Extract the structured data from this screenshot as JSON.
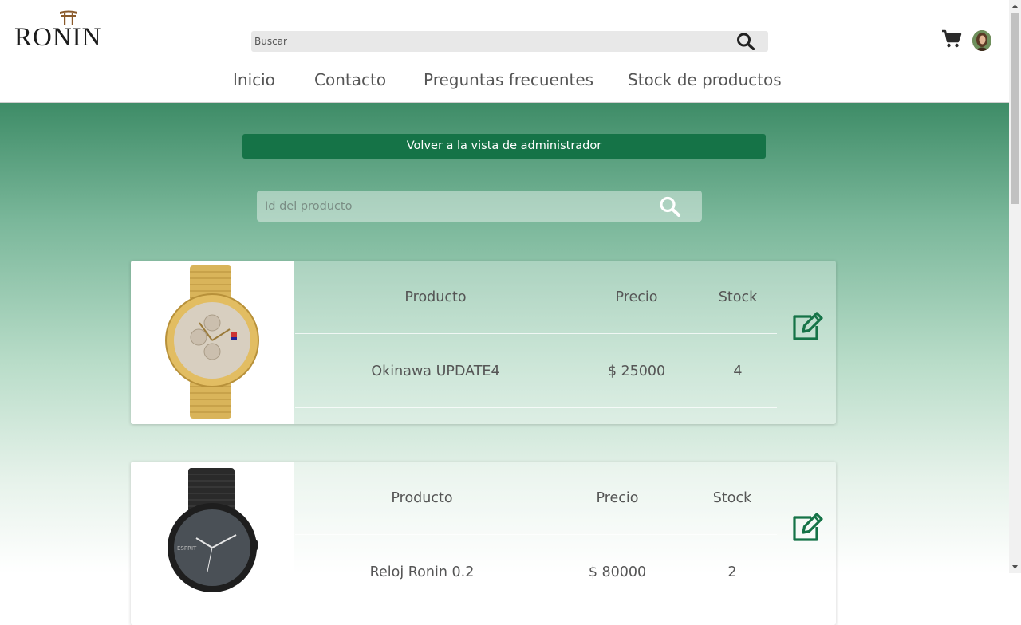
{
  "brand": {
    "logo_text": "RONIN"
  },
  "search": {
    "placeholder": "Buscar"
  },
  "nav": {
    "items": [
      {
        "label": "Inicio"
      },
      {
        "label": "Contacto"
      },
      {
        "label": "Preguntas frecuentes"
      },
      {
        "label": "Stock de productos"
      }
    ]
  },
  "admin": {
    "back_label": "Volver a la vista de administrador",
    "id_search_placeholder": "Id del producto"
  },
  "products": [
    {
      "header_product": "Producto",
      "header_price": "Precio",
      "header_stock": "Stock",
      "name": "Okinawa UPDATE4",
      "price": "$ 25000",
      "stock": "4",
      "image": "gold-watch"
    },
    {
      "header_product": "Producto",
      "header_price": "Precio",
      "header_stock": "Stock",
      "name": "Reloj Ronin 0.2",
      "price": "$ 80000",
      "stock": "2",
      "image": "black-watch"
    }
  ],
  "colors": {
    "accent": "#157347",
    "gradient_top": "#3e8c67",
    "text": "#555555"
  },
  "icons": [
    "search-icon",
    "cart-icon",
    "avatar",
    "edit-icon",
    "torii-gate-icon"
  ]
}
